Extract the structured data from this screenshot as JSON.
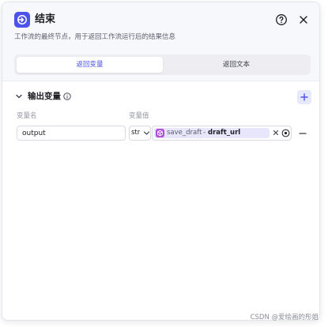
{
  "node": {
    "title": "结束",
    "description": "工作流的最终节点，用于返回工作流运行后的结果信息",
    "icon": "end-node-icon",
    "accent_color": "#4d53e8"
  },
  "header_actions": {
    "help_icon": "question-circle-icon",
    "close_icon": "close-icon"
  },
  "tabs": [
    {
      "label": "返回变量",
      "active": true
    },
    {
      "label": "返回文本",
      "active": false
    }
  ],
  "output_section": {
    "title": "输出变量",
    "info_icon": "info-icon",
    "add_icon": "plus-icon",
    "columns": {
      "name": "变量名",
      "value": "变量值"
    },
    "rows": [
      {
        "name": "output",
        "type": "str",
        "ref_node": "save_draft",
        "ref_separator": "-",
        "ref_variable": "draft_url"
      }
    ]
  },
  "watermark": "CSDN @爱绘画的彤姐"
}
